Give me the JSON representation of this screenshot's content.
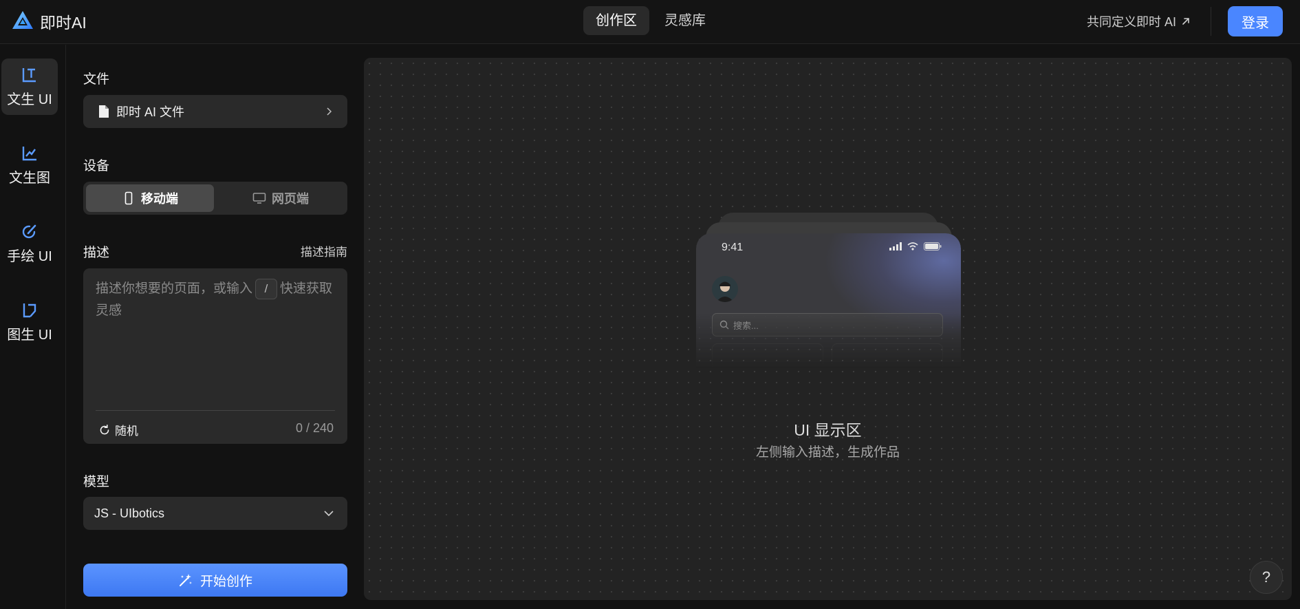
{
  "app": {
    "name": "即时AI",
    "logo_icon": "triangle-logo-icon"
  },
  "header": {
    "tabs": [
      {
        "label": "创作区",
        "active": true
      },
      {
        "label": "灵感库",
        "active": false
      }
    ],
    "cocreate_link": "共同定义即时 AI",
    "login_label": "登录",
    "accent_color": "#4a86ff"
  },
  "rail": {
    "items": [
      {
        "label": "文生 UI",
        "icon": "text-to-ui-icon",
        "active": true
      },
      {
        "label": "文生图",
        "icon": "text-to-image-icon",
        "active": false
      },
      {
        "label": "手绘 UI",
        "icon": "sketch-ui-icon",
        "active": false
      },
      {
        "label": "图生 UI",
        "icon": "image-to-ui-icon",
        "active": false
      }
    ]
  },
  "form": {
    "file": {
      "title": "文件",
      "value": "即时 AI 文件"
    },
    "device": {
      "title": "设备",
      "options": [
        {
          "label": "移动端",
          "icon": "mobile-icon",
          "selected": true
        },
        {
          "label": "网页端",
          "icon": "desktop-icon",
          "selected": false
        }
      ]
    },
    "description": {
      "title": "描述",
      "guide_link": "描述指南",
      "placeholder_before": "描述你想要的页面，或输入",
      "slash_key": "/",
      "placeholder_after": "快速获取灵感",
      "random_label": "随机",
      "counter": "0 / 240"
    },
    "model": {
      "title": "模型",
      "value": "JS - UIbotics"
    },
    "start_label": "开始创作"
  },
  "canvas": {
    "title": "UI 显示区",
    "subtitle": "左侧输入描述，生成作品",
    "phone_preview": {
      "time": "9:41",
      "search_placeholder": "搜索..."
    }
  },
  "help_label": "?"
}
